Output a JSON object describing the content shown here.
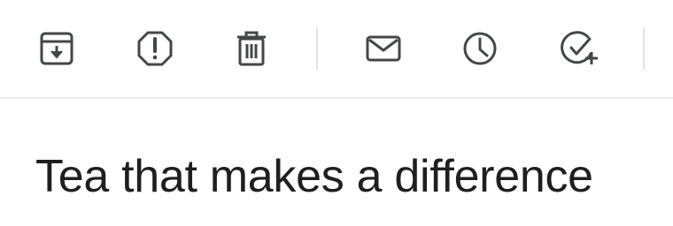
{
  "toolbar": {
    "buttons": [
      {
        "id": "archive",
        "icon": "archive-icon"
      },
      {
        "id": "report-spam",
        "icon": "report-spam-icon"
      },
      {
        "id": "delete",
        "icon": "trash-icon"
      },
      {
        "id": "mark-unread",
        "icon": "envelope-icon"
      },
      {
        "id": "snooze",
        "icon": "clock-icon"
      },
      {
        "id": "add-to-tasks",
        "icon": "add-task-icon"
      }
    ],
    "icon_color": "#444746"
  },
  "message": {
    "subject": "Tea that makes a difference"
  }
}
